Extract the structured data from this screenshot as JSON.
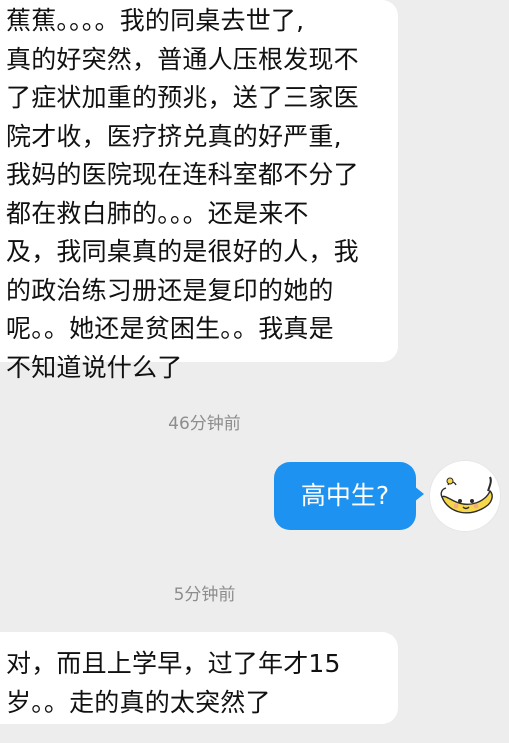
{
  "messages": [
    {
      "side": "incoming",
      "lines": [
        "蕉蕉。。。。我的同桌去世了,",
        "真的好突然，普通人压根发现不",
        "了症状加重的预兆，送了三家医",
        "院才收，医疗挤兑真的好严重,",
        "我妈的医院现在连科室都不分了",
        "都在救白肺的。。。还是来不",
        "及，我同桌真的是很好的人，我",
        "的政治练习册还是复印的她的",
        "呢。。她还是贫困生。。我真是",
        "不知道说什么了"
      ]
    },
    {
      "timestamp": "46分钟前"
    },
    {
      "side": "outgoing",
      "text": "高中生?",
      "avatar_icon": "banana-avatar-icon"
    },
    {
      "timestamp": "5分钟前"
    },
    {
      "side": "incoming",
      "lines": [
        "对，而且上学早，过了年才15",
        "岁。。走的真的太突然了"
      ]
    }
  ],
  "colors": {
    "background": "#ededed",
    "incoming_bubble": "#ffffff",
    "outgoing_bubble": "#1e92f0",
    "timestamp_text": "#8d8d8d"
  }
}
